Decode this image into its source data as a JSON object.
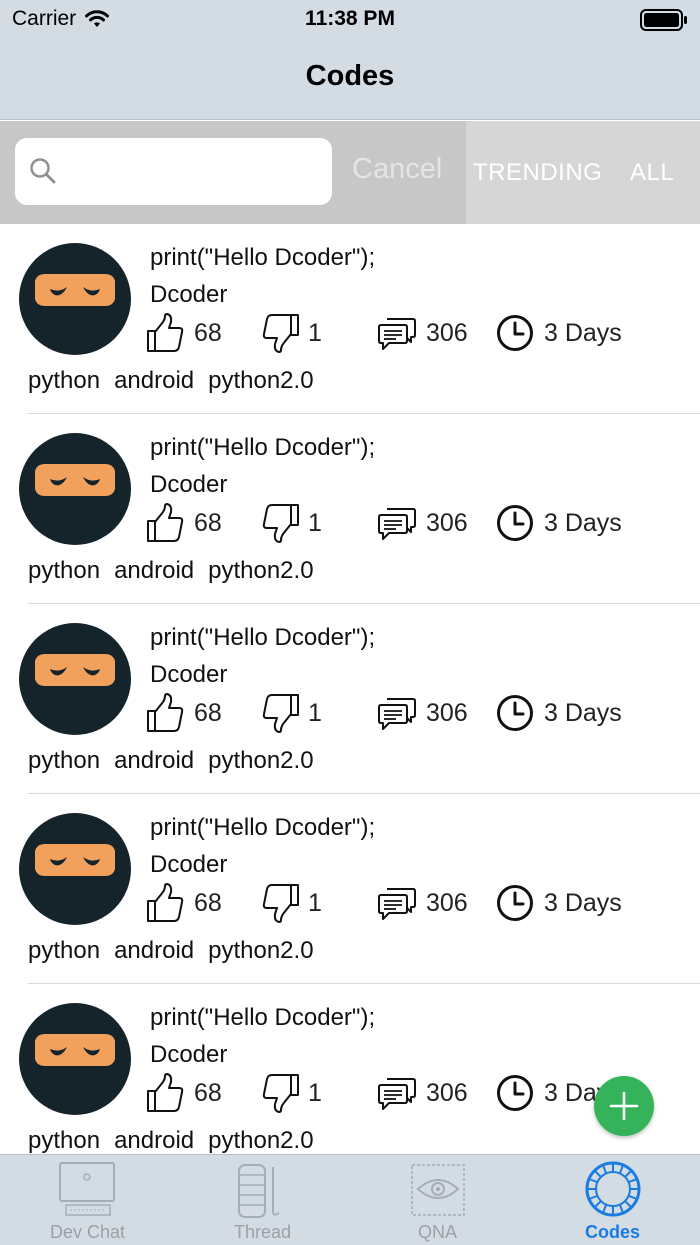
{
  "status_bar": {
    "carrier": "Carrier",
    "time": "11:38 PM",
    "icons": [
      "wifi-icon",
      "battery-icon"
    ]
  },
  "nav": {
    "title": "Codes"
  },
  "search": {
    "placeholder": "",
    "cancel_label": "Cancel",
    "icon": "search-icon"
  },
  "segments": {
    "trending": "TRENDING",
    "all": "ALL"
  },
  "posts": [
    {
      "title": "print(\"Hello Dcoder\");",
      "author": "Dcoder",
      "likes": "68",
      "dislikes": "1",
      "comments": "306",
      "age": "3 Days",
      "tags": [
        "python",
        "android",
        "python2.0"
      ]
    },
    {
      "title": "print(\"Hello Dcoder\");",
      "author": "Dcoder",
      "likes": "68",
      "dislikes": "1",
      "comments": "306",
      "age": "3 Days",
      "tags": [
        "python",
        "android",
        "python2.0"
      ]
    },
    {
      "title": "print(\"Hello Dcoder\");",
      "author": "Dcoder",
      "likes": "68",
      "dislikes": "1",
      "comments": "306",
      "age": "3 Days",
      "tags": [
        "python",
        "android",
        "python2.0"
      ]
    },
    {
      "title": "print(\"Hello Dcoder\");",
      "author": "Dcoder",
      "likes": "68",
      "dislikes": "1",
      "comments": "306",
      "age": "3 Days",
      "tags": [
        "python",
        "android",
        "python2.0"
      ]
    },
    {
      "title": "print(\"Hello Dcoder\");",
      "author": "Dcoder",
      "likes": "68",
      "dislikes": "1",
      "comments": "306",
      "age": "3 Days",
      "tags": [
        "python",
        "android",
        "python2.0"
      ]
    }
  ],
  "fab": {
    "icon": "plus-icon",
    "color": "#35b35a"
  },
  "tabs": [
    {
      "label": "Dev Chat",
      "icon": "computer-icon",
      "active": false
    },
    {
      "label": "Thread",
      "icon": "thread-icon",
      "active": false
    },
    {
      "label": "QNA",
      "icon": "eye-icon",
      "active": false
    },
    {
      "label": "Codes",
      "icon": "codes-icon",
      "active": true
    }
  ],
  "colors": {
    "bar_background": "#d3dbe3",
    "active_tab": "#1a7be0",
    "inactive_tab": "#9aa1a8",
    "avatar_background": "#15232b",
    "avatar_mask": "#f2a15c"
  }
}
